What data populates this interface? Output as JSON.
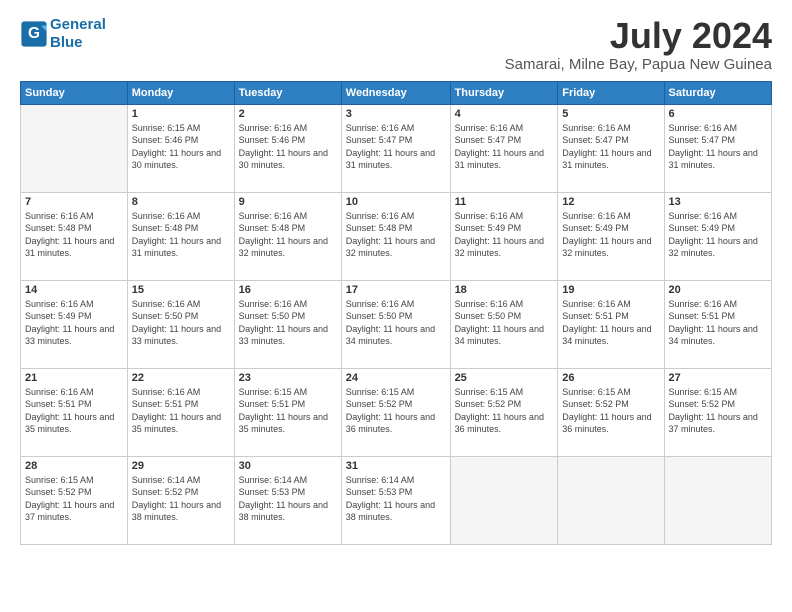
{
  "header": {
    "logo_line1": "General",
    "logo_line2": "Blue",
    "month": "July 2024",
    "location": "Samarai, Milne Bay, Papua New Guinea"
  },
  "days_of_week": [
    "Sunday",
    "Monday",
    "Tuesday",
    "Wednesday",
    "Thursday",
    "Friday",
    "Saturday"
  ],
  "weeks": [
    [
      {
        "day": "",
        "sunrise": "",
        "sunset": "",
        "daylight": ""
      },
      {
        "day": "1",
        "sunrise": "6:15 AM",
        "sunset": "5:46 PM",
        "daylight": "11 hours and 30 minutes."
      },
      {
        "day": "2",
        "sunrise": "6:16 AM",
        "sunset": "5:46 PM",
        "daylight": "11 hours and 30 minutes."
      },
      {
        "day": "3",
        "sunrise": "6:16 AM",
        "sunset": "5:47 PM",
        "daylight": "11 hours and 31 minutes."
      },
      {
        "day": "4",
        "sunrise": "6:16 AM",
        "sunset": "5:47 PM",
        "daylight": "11 hours and 31 minutes."
      },
      {
        "day": "5",
        "sunrise": "6:16 AM",
        "sunset": "5:47 PM",
        "daylight": "11 hours and 31 minutes."
      },
      {
        "day": "6",
        "sunrise": "6:16 AM",
        "sunset": "5:47 PM",
        "daylight": "11 hours and 31 minutes."
      }
    ],
    [
      {
        "day": "7",
        "sunrise": "6:16 AM",
        "sunset": "5:48 PM",
        "daylight": "11 hours and 31 minutes."
      },
      {
        "day": "8",
        "sunrise": "6:16 AM",
        "sunset": "5:48 PM",
        "daylight": "11 hours and 31 minutes."
      },
      {
        "day": "9",
        "sunrise": "6:16 AM",
        "sunset": "5:48 PM",
        "daylight": "11 hours and 32 minutes."
      },
      {
        "day": "10",
        "sunrise": "6:16 AM",
        "sunset": "5:48 PM",
        "daylight": "11 hours and 32 minutes."
      },
      {
        "day": "11",
        "sunrise": "6:16 AM",
        "sunset": "5:49 PM",
        "daylight": "11 hours and 32 minutes."
      },
      {
        "day": "12",
        "sunrise": "6:16 AM",
        "sunset": "5:49 PM",
        "daylight": "11 hours and 32 minutes."
      },
      {
        "day": "13",
        "sunrise": "6:16 AM",
        "sunset": "5:49 PM",
        "daylight": "11 hours and 32 minutes."
      }
    ],
    [
      {
        "day": "14",
        "sunrise": "6:16 AM",
        "sunset": "5:49 PM",
        "daylight": "11 hours and 33 minutes."
      },
      {
        "day": "15",
        "sunrise": "6:16 AM",
        "sunset": "5:50 PM",
        "daylight": "11 hours and 33 minutes."
      },
      {
        "day": "16",
        "sunrise": "6:16 AM",
        "sunset": "5:50 PM",
        "daylight": "11 hours and 33 minutes."
      },
      {
        "day": "17",
        "sunrise": "6:16 AM",
        "sunset": "5:50 PM",
        "daylight": "11 hours and 34 minutes."
      },
      {
        "day": "18",
        "sunrise": "6:16 AM",
        "sunset": "5:50 PM",
        "daylight": "11 hours and 34 minutes."
      },
      {
        "day": "19",
        "sunrise": "6:16 AM",
        "sunset": "5:51 PM",
        "daylight": "11 hours and 34 minutes."
      },
      {
        "day": "20",
        "sunrise": "6:16 AM",
        "sunset": "5:51 PM",
        "daylight": "11 hours and 34 minutes."
      }
    ],
    [
      {
        "day": "21",
        "sunrise": "6:16 AM",
        "sunset": "5:51 PM",
        "daylight": "11 hours and 35 minutes."
      },
      {
        "day": "22",
        "sunrise": "6:16 AM",
        "sunset": "5:51 PM",
        "daylight": "11 hours and 35 minutes."
      },
      {
        "day": "23",
        "sunrise": "6:15 AM",
        "sunset": "5:51 PM",
        "daylight": "11 hours and 35 minutes."
      },
      {
        "day": "24",
        "sunrise": "6:15 AM",
        "sunset": "5:52 PM",
        "daylight": "11 hours and 36 minutes."
      },
      {
        "day": "25",
        "sunrise": "6:15 AM",
        "sunset": "5:52 PM",
        "daylight": "11 hours and 36 minutes."
      },
      {
        "day": "26",
        "sunrise": "6:15 AM",
        "sunset": "5:52 PM",
        "daylight": "11 hours and 36 minutes."
      },
      {
        "day": "27",
        "sunrise": "6:15 AM",
        "sunset": "5:52 PM",
        "daylight": "11 hours and 37 minutes."
      }
    ],
    [
      {
        "day": "28",
        "sunrise": "6:15 AM",
        "sunset": "5:52 PM",
        "daylight": "11 hours and 37 minutes."
      },
      {
        "day": "29",
        "sunrise": "6:14 AM",
        "sunset": "5:52 PM",
        "daylight": "11 hours and 38 minutes."
      },
      {
        "day": "30",
        "sunrise": "6:14 AM",
        "sunset": "5:53 PM",
        "daylight": "11 hours and 38 minutes."
      },
      {
        "day": "31",
        "sunrise": "6:14 AM",
        "sunset": "5:53 PM",
        "daylight": "11 hours and 38 minutes."
      },
      {
        "day": "",
        "sunrise": "",
        "sunset": "",
        "daylight": ""
      },
      {
        "day": "",
        "sunrise": "",
        "sunset": "",
        "daylight": ""
      },
      {
        "day": "",
        "sunrise": "",
        "sunset": "",
        "daylight": ""
      }
    ]
  ]
}
